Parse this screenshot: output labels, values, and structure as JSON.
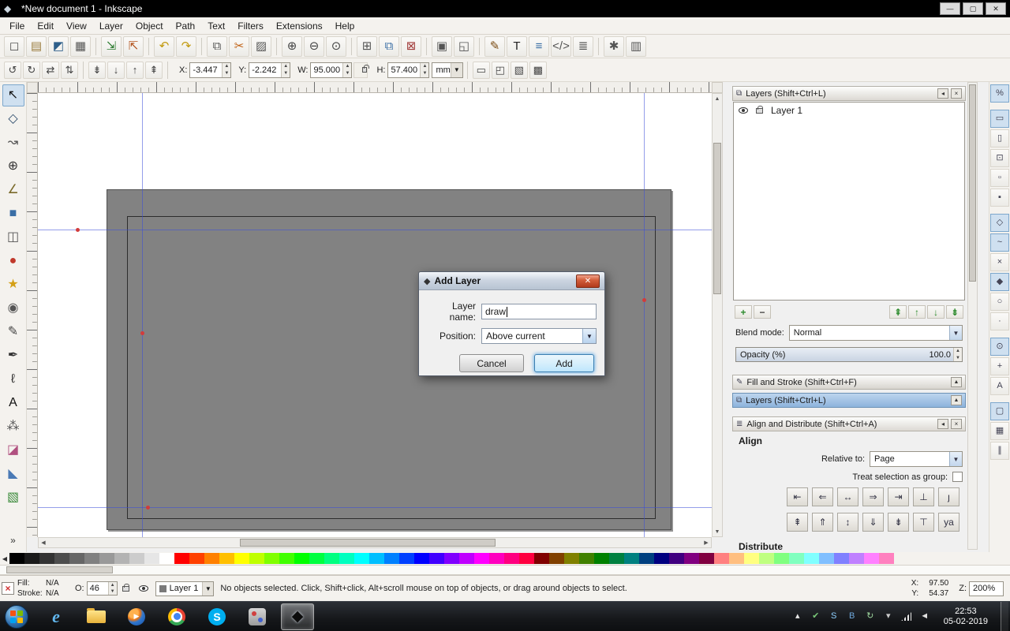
{
  "window": {
    "title": "*New document 1 - Inkscape",
    "controls": [
      {
        "name": "minimize-button",
        "glyph": "—"
      },
      {
        "name": "maximize-button",
        "glyph": "▢"
      },
      {
        "name": "close-button",
        "glyph": "✕"
      }
    ]
  },
  "menu": {
    "items": [
      "File",
      "Edit",
      "View",
      "Layer",
      "Object",
      "Path",
      "Text",
      "Filters",
      "Extensions",
      "Help"
    ]
  },
  "command_bar": {
    "groups": [
      [
        {
          "name": "new-document",
          "glyph": "◻",
          "color": "#555555"
        },
        {
          "name": "open-document",
          "glyph": "▤",
          "color": "#9a7b3c"
        },
        {
          "name": "save-document",
          "glyph": "◩",
          "color": "#2e5f8a"
        },
        {
          "name": "print-document",
          "glyph": "▦",
          "color": "#555555"
        }
      ],
      [
        {
          "name": "import-image",
          "glyph": "⇲",
          "color": "#2e7d32"
        },
        {
          "name": "export-image",
          "glyph": "⇱",
          "color": "#b3541e"
        }
      ],
      [
        {
          "name": "undo",
          "glyph": "↶",
          "color": "#c29a10"
        },
        {
          "name": "redo",
          "glyph": "↷",
          "color": "#c29a10"
        }
      ],
      [
        {
          "name": "copy",
          "glyph": "⧉",
          "color": "#555555"
        },
        {
          "name": "cut",
          "glyph": "✂",
          "color": "#c06014"
        },
        {
          "name": "paste",
          "glyph": "▨",
          "color": "#555555"
        }
      ],
      [
        {
          "name": "zoom-to-selection",
          "glyph": "⊕",
          "color": "#444444"
        },
        {
          "name": "zoom-to-drawing",
          "glyph": "⊖",
          "color": "#444444"
        },
        {
          "name": "zoom-to-page",
          "glyph": "⊙",
          "color": "#444444"
        }
      ],
      [
        {
          "name": "duplicate",
          "glyph": "⊞",
          "color": "#555555"
        },
        {
          "name": "create-clone",
          "glyph": "⧉",
          "color": "#3a6ea5"
        },
        {
          "name": "unlink-clone",
          "glyph": "⊠",
          "color": "#a23b3b"
        }
      ],
      [
        {
          "name": "group-objects",
          "glyph": "▣",
          "color": "#555555"
        },
        {
          "name": "ungroup-objects",
          "glyph": "◱",
          "color": "#555555"
        }
      ],
      [
        {
          "name": "fill-stroke-dialog",
          "glyph": "✎",
          "color": "#7a4a12"
        },
        {
          "name": "text-dialog",
          "glyph": "T",
          "color": "#222222"
        },
        {
          "name": "layers-dialog",
          "glyph": "≡",
          "color": "#3a6ea5"
        },
        {
          "name": "xml-editor",
          "glyph": "</>",
          "color": "#555555"
        },
        {
          "name": "align-dialog",
          "glyph": "≣",
          "color": "#555555"
        }
      ],
      [
        {
          "name": "preferences",
          "glyph": "✱",
          "color": "#555555"
        },
        {
          "name": "document-properties",
          "glyph": "▥",
          "color": "#555555"
        }
      ]
    ]
  },
  "tool_controls": {
    "buttons": [
      [
        {
          "name": "rotate-90-ccw",
          "glyph": "↺",
          "color": "#444444"
        },
        {
          "name": "rotate-90-cw",
          "glyph": "↻",
          "color": "#444444"
        },
        {
          "name": "flip-horizontal",
          "glyph": "⇄",
          "color": "#444444"
        },
        {
          "name": "flip-vertical",
          "glyph": "⇅",
          "color": "#444444"
        }
      ],
      [
        {
          "name": "lower-to-bottom",
          "glyph": "⇟",
          "color": "#444444"
        },
        {
          "name": "lower-selection",
          "glyph": "↓",
          "color": "#444444"
        },
        {
          "name": "raise-selection",
          "glyph": "↑",
          "color": "#444444"
        },
        {
          "name": "raise-to-top",
          "glyph": "⇞",
          "color": "#444444"
        }
      ]
    ],
    "x_label": "X:",
    "x_value": "-3.447",
    "y_label": "Y:",
    "y_value": "-2.242",
    "w_label": "W:",
    "w_value": "95.000",
    "h_label": "H:",
    "h_value": "57.400",
    "unit": "mm",
    "affect_toggles": [
      {
        "name": "scale-stroke-toggle",
        "glyph": "▭",
        "color": "#444444"
      },
      {
        "name": "scale-corners-toggle",
        "glyph": "◰",
        "color": "#444444"
      },
      {
        "name": "move-gradients-toggle",
        "glyph": "▧",
        "color": "#444444"
      },
      {
        "name": "move-patterns-toggle",
        "glyph": "▩",
        "color": "#444444"
      }
    ]
  },
  "toolbox": {
    "overflow_glyph": "»",
    "tools": [
      {
        "name": "selector-tool",
        "glyph": "↖",
        "color": "#111111",
        "active": true
      },
      {
        "name": "node-tool",
        "glyph": "◇",
        "color": "#2b4a6b"
      },
      {
        "name": "tweak-tool",
        "glyph": "↝",
        "color": "#555555"
      },
      {
        "name": "zoom-tool",
        "glyph": "⊕",
        "color": "#333333"
      },
      {
        "name": "measure-tool",
        "glyph": "∠",
        "color": "#7a6a2a"
      },
      {
        "name": "rectangle-tool",
        "glyph": "■",
        "color": "#3a6ea5"
      },
      {
        "name": "3dbox-tool",
        "glyph": "◫",
        "color": "#555555"
      },
      {
        "name": "ellipse-tool",
        "glyph": "●",
        "color": "#c0392b"
      },
      {
        "name": "star-tool",
        "glyph": "★",
        "color": "#d4a017"
      },
      {
        "name": "spiral-tool",
        "glyph": "◉",
        "color": "#555555"
      },
      {
        "name": "pencil-tool",
        "glyph": "✎",
        "color": "#444444"
      },
      {
        "name": "bezier-tool",
        "glyph": "✒",
        "color": "#333333"
      },
      {
        "name": "calligraphy-tool",
        "glyph": "ℓ",
        "color": "#333333"
      },
      {
        "name": "text-tool",
        "glyph": "A",
        "color": "#111111"
      },
      {
        "name": "spray-tool",
        "glyph": "⁂",
        "color": "#555555"
      },
      {
        "name": "eraser-tool",
        "glyph": "◪",
        "color": "#b05080"
      },
      {
        "name": "bucket-tool",
        "glyph": "◣",
        "color": "#4a7ab5"
      },
      {
        "name": "gradient-tool",
        "glyph": "▧",
        "color": "#3a8a3a"
      }
    ]
  },
  "snap_bar": {
    "groups": [
      [
        {
          "name": "snap-enable-toggle",
          "glyph": "%",
          "active": true
        }
      ],
      [
        {
          "name": "snap-bounding-box-toggle",
          "glyph": "▭",
          "active": true
        },
        {
          "name": "snap-bbox-edges-toggle",
          "glyph": "▯"
        },
        {
          "name": "snap-bbox-corners-toggle",
          "glyph": "⊡"
        },
        {
          "name": "snap-bbox-edge-midpoints-toggle",
          "glyph": "▫"
        },
        {
          "name": "snap-bbox-centers-toggle",
          "glyph": "▪"
        }
      ],
      [
        {
          "name": "snap-nodes-toggle",
          "glyph": "◇",
          "active": true
        },
        {
          "name": "snap-paths-toggle",
          "glyph": "~",
          "active": true
        },
        {
          "name": "snap-path-intersections-toggle",
          "glyph": "×"
        },
        {
          "name": "snap-cusp-nodes-toggle",
          "glyph": "◆",
          "active": true
        },
        {
          "name": "snap-smooth-nodes-toggle",
          "glyph": "○"
        },
        {
          "name": "snap-midpoints-toggle",
          "glyph": "·"
        }
      ],
      [
        {
          "name": "snap-object-centers-toggle",
          "glyph": "⊙",
          "active": true
        },
        {
          "name": "snap-rotation-centers-toggle",
          "glyph": "+"
        },
        {
          "name": "snap-text-baseline-toggle",
          "glyph": "A"
        }
      ],
      [
        {
          "name": "snap-page-border-toggle",
          "glyph": "▢",
          "active": true
        },
        {
          "name": "snap-grid-toggle",
          "glyph": "▦"
        },
        {
          "name": "snap-guide-toggle",
          "glyph": "∥"
        }
      ]
    ]
  },
  "layers_panel": {
    "title": "Layers (Shift+Ctrl+L)",
    "layer_name": "Layer 1",
    "actions_left": [
      {
        "name": "new-layer-button",
        "glyph": "+",
        "color": "#2e8b2e"
      },
      {
        "name": "delete-layer-button",
        "glyph": "−",
        "color": "#444444"
      }
    ],
    "actions_right": [
      {
        "name": "raise-layer-to-top-button",
        "glyph": "⇞",
        "color": "#2e8b2e"
      },
      {
        "name": "raise-layer-button",
        "glyph": "↑",
        "color": "#2e8b2e"
      },
      {
        "name": "lower-layer-button",
        "glyph": "↓",
        "color": "#2e8b2e"
      },
      {
        "name": "lower-layer-to-bottom-button",
        "glyph": "⇟",
        "color": "#2e8b2e"
      }
    ],
    "blend_label": "Blend mode:",
    "blend_value": "Normal",
    "opacity_label": "Opacity (%)",
    "opacity_value": "100.0"
  },
  "docked_bars": {
    "fill_stroke": "Fill and Stroke (Shift+Ctrl+F)",
    "layers": "Layers (Shift+Ctrl+L)"
  },
  "align_panel": {
    "title": "Align and Distribute (Shift+Ctrl+A)",
    "align_heading": "Align",
    "relative_label": "Relative to:",
    "relative_value": "Page",
    "group_label": "Treat selection as group:",
    "distribute_heading": "Distribute",
    "rows": [
      [
        {
          "name": "align-right-edges-to-left-anchor-button",
          "glyph": "⇤"
        },
        {
          "name": "align-left-edges-button",
          "glyph": "⇐"
        },
        {
          "name": "center-on-vertical-axis-button",
          "glyph": "↔"
        },
        {
          "name": "align-right-edges-button",
          "glyph": "⇒"
        },
        {
          "name": "align-left-edges-to-right-anchor-button",
          "glyph": "⇥"
        },
        {
          "name": "align-baseline-horizontal-button",
          "glyph": "⊥"
        },
        {
          "name": "text-anchor-horizontal-button",
          "glyph": "ȷ"
        }
      ],
      [
        {
          "name": "align-bottom-edges-to-top-anchor-button",
          "glyph": "⇞"
        },
        {
          "name": "align-top-edges-button",
          "glyph": "⇑"
        },
        {
          "name": "center-on-horizontal-axis-button",
          "glyph": "↕"
        },
        {
          "name": "align-bottom-edges-button",
          "glyph": "⇓"
        },
        {
          "name": "align-top-edges-to-bottom-anchor-button",
          "glyph": "⇟"
        },
        {
          "name": "align-baseline-vertical-button",
          "glyph": "⊤"
        },
        {
          "name": "text-anchor-vertical-button",
          "glyph": "ya"
        }
      ]
    ]
  },
  "palette": {
    "colors": [
      "#000000",
      "#1a1a1a",
      "#333333",
      "#4d4d4d",
      "#666666",
      "#808080",
      "#999999",
      "#b3b3b3",
      "#cccccc",
      "#e6e6e6",
      "#ffffff",
      "#ff0000",
      "#ff4000",
      "#ff8000",
      "#ffbf00",
      "#ffff00",
      "#bfff00",
      "#80ff00",
      "#40ff00",
      "#00ff00",
      "#00ff40",
      "#00ff80",
      "#00ffbf",
      "#00ffff",
      "#00bfff",
      "#0080ff",
      "#0040ff",
      "#0000ff",
      "#4000ff",
      "#8000ff",
      "#bf00ff",
      "#ff00ff",
      "#ff00bf",
      "#ff0080",
      "#ff0040",
      "#800000",
      "#804000",
      "#808000",
      "#408000",
      "#008000",
      "#008040",
      "#008080",
      "#004080",
      "#000080",
      "#400080",
      "#800080",
      "#800040",
      "#ff8080",
      "#ffbf80",
      "#ffff80",
      "#bfff80",
      "#80ff80",
      "#80ffbf",
      "#80ffff",
      "#80bfff",
      "#8080ff",
      "#bf80ff",
      "#ff80ff",
      "#ff80bf"
    ]
  },
  "status_bar": {
    "fill_label": "Fill:",
    "fill_value": "N/A",
    "stroke_label": "Stroke:",
    "stroke_value": "N/A",
    "opacity_label": "O:",
    "opacity_value": "46",
    "layer_label": "Layer 1",
    "message": "No objects selected. Click, Shift+click, Alt+scroll mouse on top of objects, or drag around objects to select.",
    "x_label": "X:",
    "x_value": "97.50",
    "y_label": "Y:",
    "y_value": "54.37",
    "z_label": "Z:",
    "z_value": "200%"
  },
  "dialog": {
    "title": "Add Layer",
    "name_label": "Layer name:",
    "name_value": "draw",
    "position_label": "Position:",
    "position_value": "Above current",
    "cancel_label": "Cancel",
    "add_label": "Add"
  },
  "taskbar": {
    "time": "22:53",
    "date": "05-02-2019",
    "apps": [
      {
        "name": "internet-explorer",
        "cls": "ic-ie",
        "glyph": "e"
      },
      {
        "name": "file-explorer",
        "cls": "ic-folder",
        "glyph": ""
      },
      {
        "name": "media-player",
        "cls": "ic-wmp",
        "glyph": "▶"
      },
      {
        "name": "google-chrome",
        "cls": "ic-chrome",
        "glyph": ""
      },
      {
        "name": "skype",
        "cls": "ic-skype",
        "glyph": "S"
      },
      {
        "name": "paint-app",
        "cls": "ic-paint",
        "glyph": ""
      },
      {
        "name": "inkscape",
        "cls": "ic-inkscape",
        "glyph": "◆",
        "active": true
      }
    ],
    "tray": [
      {
        "name": "show-hidden-icons",
        "glyph": "▴",
        "color": "#e8e8e8"
      },
      {
        "name": "security-status",
        "glyph": "✔",
        "color": "#79c879"
      },
      {
        "name": "skype-tray",
        "glyph": "S",
        "color": "#8fd0ff"
      },
      {
        "name": "bluetooth",
        "glyph": "B",
        "color": "#6fa8dc"
      },
      {
        "name": "sync-status",
        "glyph": "↻",
        "color": "#9fd89f"
      },
      {
        "name": "input-device",
        "glyph": "▾",
        "color": "#cccccc"
      },
      {
        "name": "network-status",
        "cls": "net-bars",
        "glyph": ""
      },
      {
        "name": "volume",
        "glyph": "◄",
        "color": "#e0e0e0"
      }
    ]
  }
}
